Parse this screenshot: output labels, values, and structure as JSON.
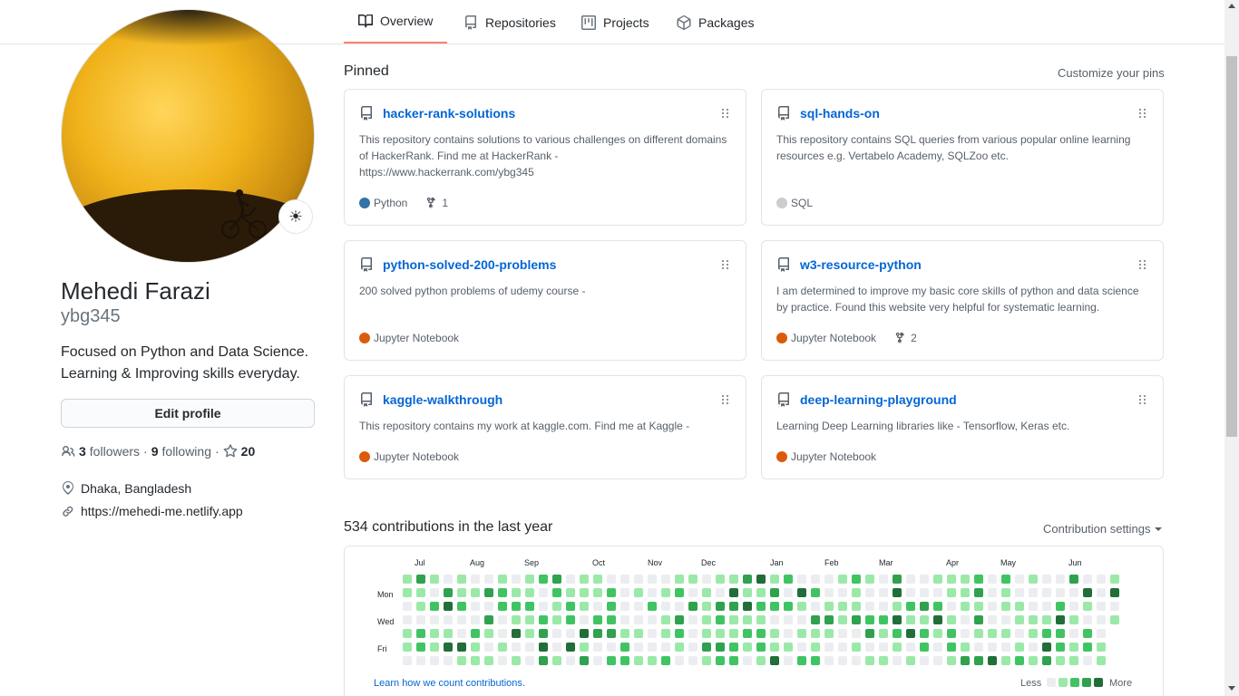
{
  "tabs": [
    {
      "label": "Overview",
      "icon": "book-icon",
      "active": true
    },
    {
      "label": "Repositories",
      "icon": "repo-icon",
      "active": false
    },
    {
      "label": "Projects",
      "icon": "project-icon",
      "active": false
    },
    {
      "label": "Packages",
      "icon": "package-icon",
      "active": false
    }
  ],
  "profile": {
    "name": "Mehedi Farazi",
    "login": "ybg345",
    "bio": "Focused on Python and Data Science. Learning & Improving skills everyday.",
    "edit_label": "Edit profile",
    "followers_count": "3",
    "followers_label": "followers",
    "separator": "·",
    "following_count": "9",
    "following_label": "following",
    "stars_count": "20",
    "location": "Dhaka, Bangladesh",
    "website": "https://mehedi-me.netlify.app",
    "status_emoji": "☀"
  },
  "pinned": {
    "title": "Pinned",
    "customize_label": "Customize your pins",
    "repos": [
      {
        "name": "hacker-rank-solutions",
        "desc": "This repository contains solutions to various challenges on different domains of HackerRank. Find me at HackerRank - https://www.hackerrank.com/ybg345",
        "language": "Python",
        "lang_color": "#3572A5",
        "forks": "1"
      },
      {
        "name": "sql-hands-on",
        "desc": "This repository contains SQL queries from various popular online learning resources e.g. Vertabelo Academy, SQLZoo etc.",
        "language": "SQL",
        "lang_color": "#cccccc",
        "forks": ""
      },
      {
        "name": "python-solved-200-problems",
        "desc": "200 solved python problems of udemy course -",
        "language": "Jupyter Notebook",
        "lang_color": "#DA5B0B",
        "forks": ""
      },
      {
        "name": "w3-resource-python",
        "desc": "I am determined to improve my basic core skills of python and data science by practice. Found this website very helpful for systematic learning.",
        "language": "Jupyter Notebook",
        "lang_color": "#DA5B0B",
        "forks": "2"
      },
      {
        "name": "kaggle-walkthrough",
        "desc": "This repository contains my work at kaggle.com. Find me at Kaggle -",
        "language": "Jupyter Notebook",
        "lang_color": "#DA5B0B",
        "forks": ""
      },
      {
        "name": "deep-learning-playground",
        "desc": "Learning Deep Learning libraries like - Tensorflow, Keras etc.",
        "language": "Jupyter Notebook",
        "lang_color": "#DA5B0B",
        "forks": ""
      }
    ]
  },
  "contributions": {
    "title": "534 contributions in the last year",
    "settings_label": "Contribution settings",
    "months": [
      "Jul",
      "Aug",
      "Sep",
      "Oct",
      "Nov",
      "Dec",
      "Jan",
      "Feb",
      "Mar",
      "Apr",
      "May",
      "Jun"
    ],
    "days": [
      "Mon",
      "Wed",
      "Fri"
    ],
    "learn_label": "Learn how we count contributions.",
    "less_label": "Less",
    "more_label": "More",
    "colors": [
      "#ebedf0",
      "#9be9a8",
      "#40c463",
      "#30a14e",
      "#216e39"
    ]
  }
}
